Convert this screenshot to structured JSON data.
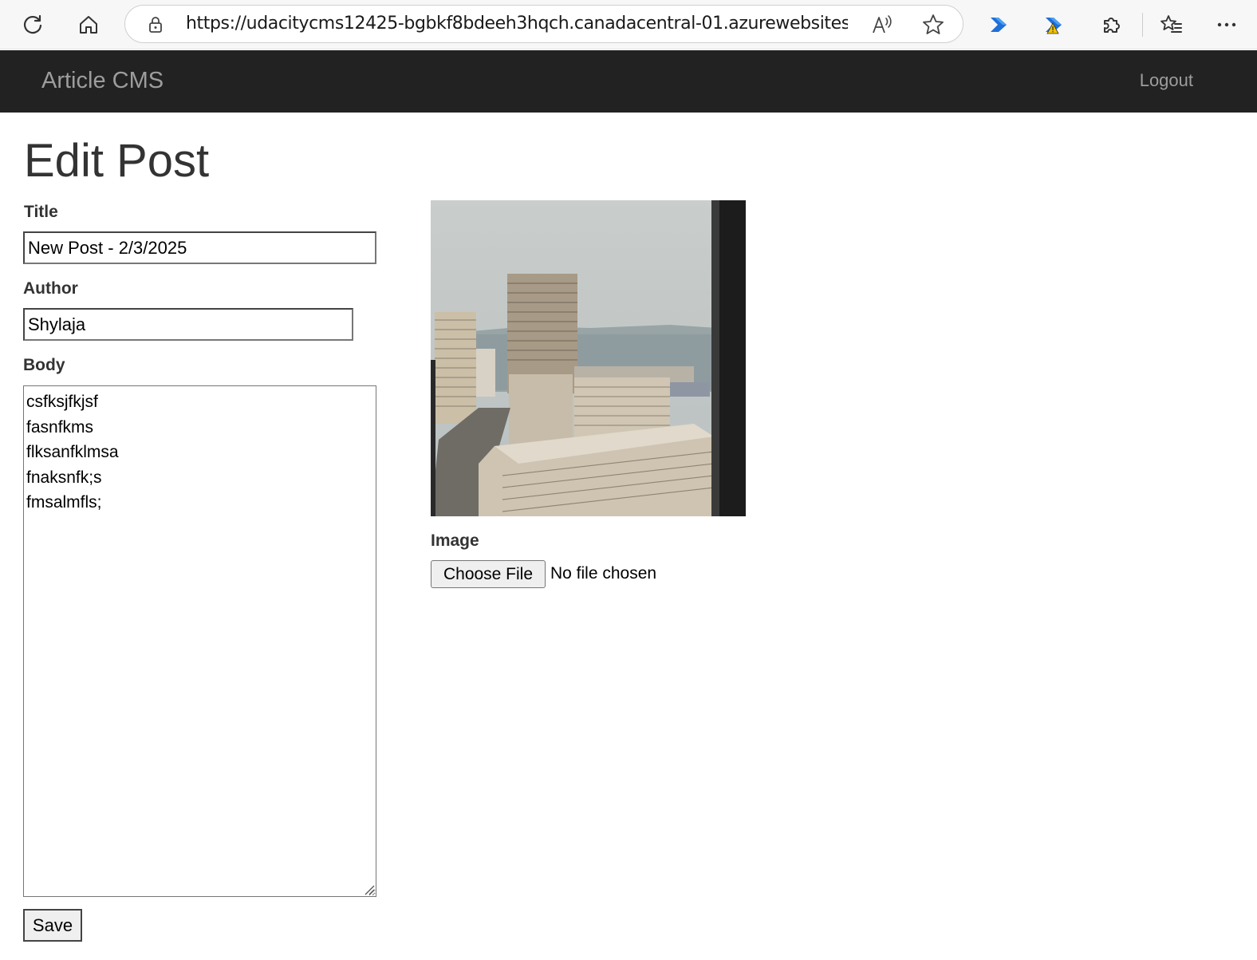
{
  "browser": {
    "url": "https://udacitycms12425-bgbkf8bdeeh3hqch.canadacentral-01.azurewebsites.net/p..."
  },
  "navbar": {
    "brand": "Article CMS",
    "logout_label": "Logout"
  },
  "page": {
    "title": "Edit Post"
  },
  "form": {
    "title_label": "Title",
    "title_value": "New Post - 2/3/2025",
    "author_label": "Author",
    "author_value": "Shylaja",
    "body_label": "Body",
    "body_lines": [
      "csfksjfkjsf",
      "fasnfkms",
      "flksanfklmsa",
      "fnaksnfk;s",
      "fmsalmfls;"
    ],
    "image_label": "Image",
    "choose_file_label": "Choose File",
    "file_status": "No file chosen",
    "save_label": "Save"
  },
  "colors": {
    "navbar_bg": "#222222",
    "navbar_text": "#9d9d9d",
    "heading_text": "#333333"
  },
  "icons": [
    "refresh-icon",
    "home-icon",
    "lock-icon",
    "read-aloud-icon",
    "favorite-star-icon",
    "power-automate-icon",
    "power-automate-warning-icon",
    "extensions-icon",
    "favorites-icon",
    "more-icon"
  ]
}
